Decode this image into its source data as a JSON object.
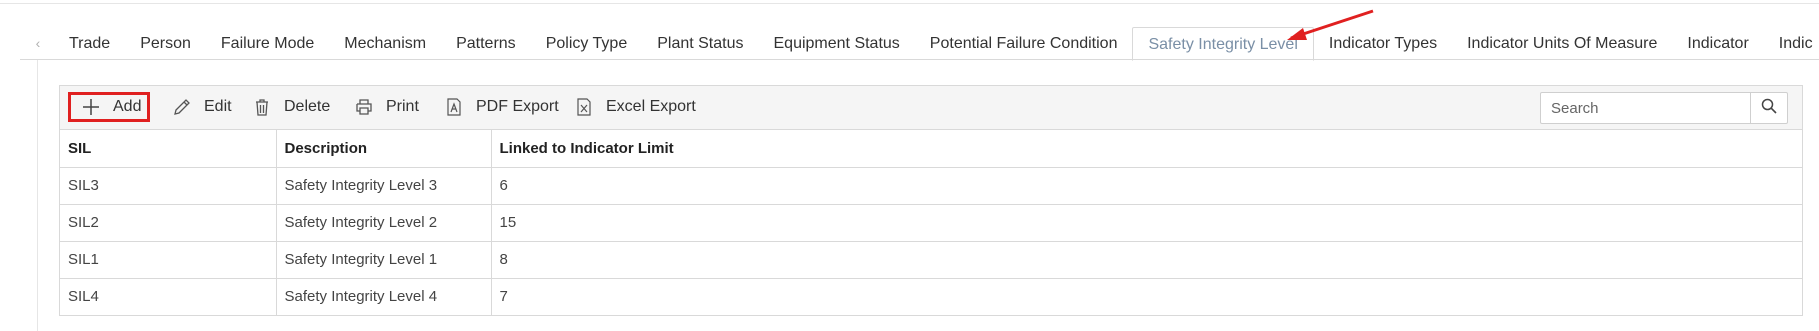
{
  "tabs": {
    "items": [
      {
        "label": "Trade"
      },
      {
        "label": "Person"
      },
      {
        "label": "Failure Mode"
      },
      {
        "label": "Mechanism"
      },
      {
        "label": "Patterns"
      },
      {
        "label": "Policy Type"
      },
      {
        "label": "Plant Status"
      },
      {
        "label": "Equipment Status"
      },
      {
        "label": "Potential Failure Condition"
      },
      {
        "label": "Safety Integrity Level"
      },
      {
        "label": "Indicator Types"
      },
      {
        "label": "Indicator Units Of Measure"
      },
      {
        "label": "Indicator"
      },
      {
        "label": "Indic"
      }
    ],
    "active_index": 9,
    "scroll_left_icon": "chevron-left-icon"
  },
  "toolbar": {
    "add_label": "Add",
    "edit_label": "Edit",
    "delete_label": "Delete",
    "print_label": "Print",
    "pdf_label": "PDF Export",
    "excel_label": "Excel Export",
    "search_placeholder": "Search"
  },
  "table": {
    "columns": [
      "SIL",
      "Description",
      "Linked to Indicator Limit"
    ],
    "rows": [
      [
        "SIL3",
        "Safety Integrity Level 3",
        "6"
      ],
      [
        "SIL2",
        "Safety Integrity Level 2",
        "15"
      ],
      [
        "SIL1",
        "Safety Integrity Level 1",
        "8"
      ],
      [
        "SIL4",
        "Safety Integrity Level 4",
        "7"
      ]
    ]
  },
  "colors": {
    "highlight": "#e02020",
    "active_tab_text": "#7a8fa6"
  }
}
